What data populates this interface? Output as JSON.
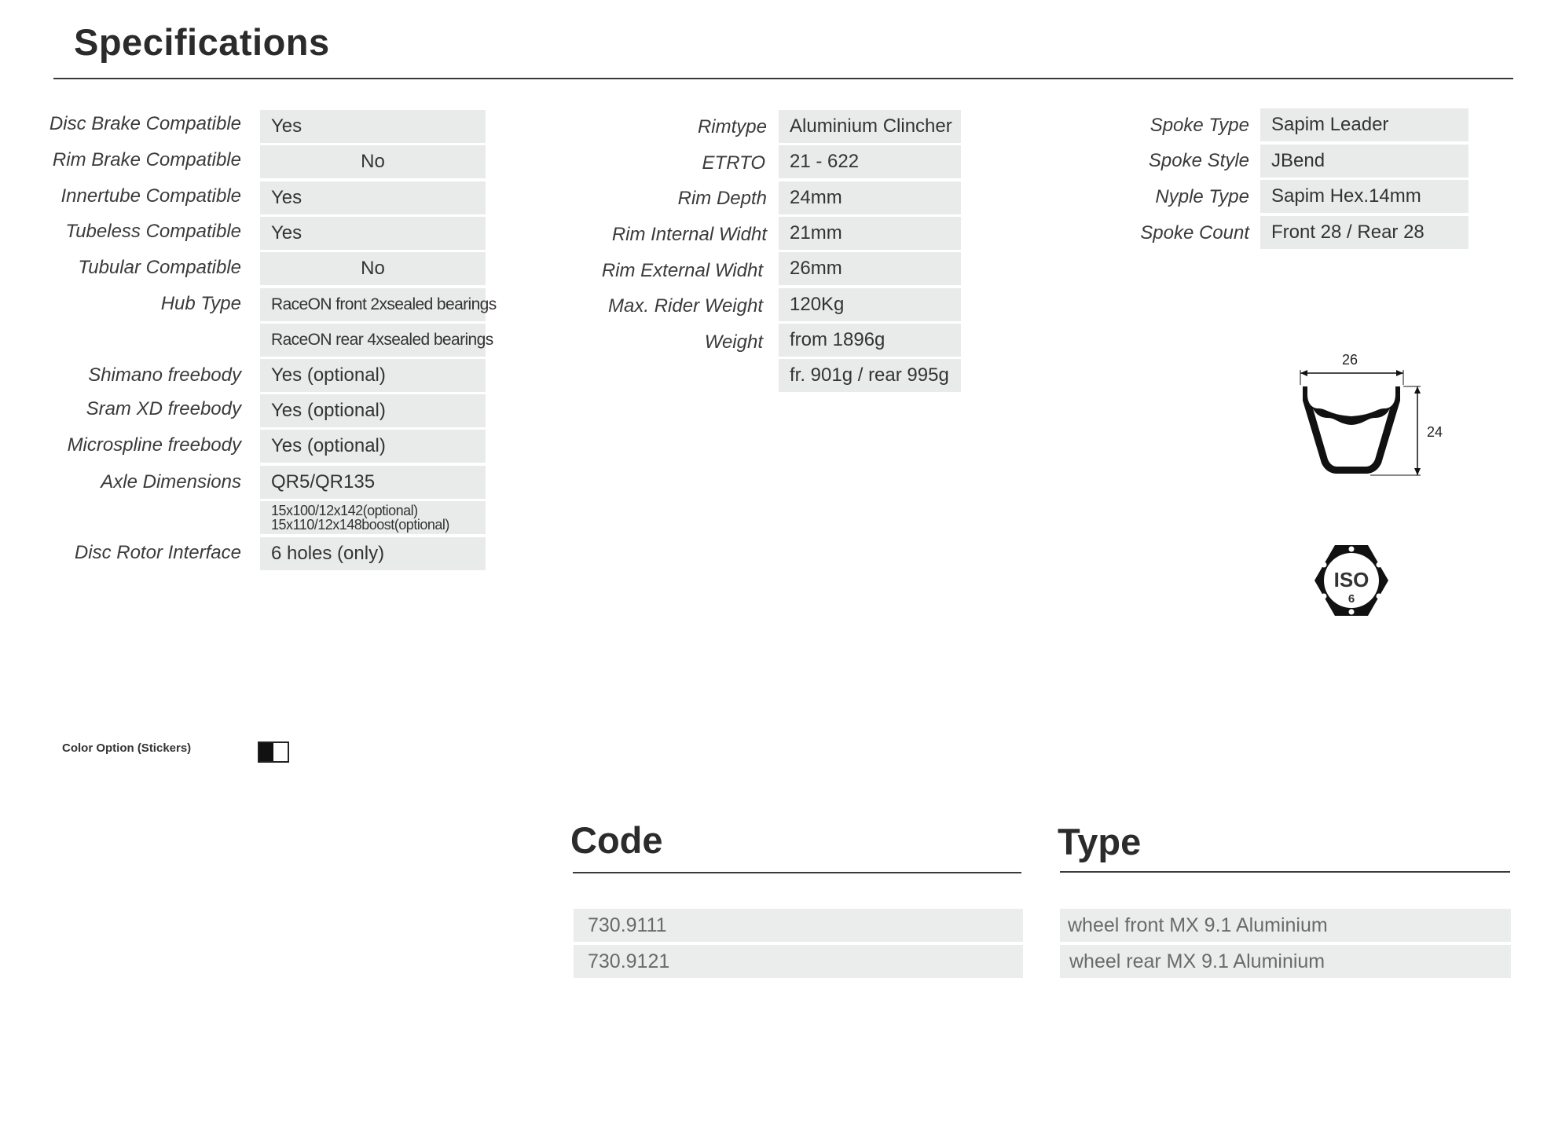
{
  "title": "Specifications",
  "col1": [
    {
      "label": "Disc Brake Compatible",
      "value": "Yes"
    },
    {
      "label": "Rim Brake Compatible",
      "value": "No"
    },
    {
      "label": "Innertube Compatible",
      "value": "Yes"
    },
    {
      "label": "Tubeless Compatible",
      "value": "Yes"
    },
    {
      "label": "Tubular Compatible",
      "value": "No"
    },
    {
      "label": "Hub Type",
      "value": "RaceON front 2xsealed bearings"
    },
    {
      "label": "",
      "value": "RaceON rear 4xsealed bearings"
    },
    {
      "label": "Shimano freebody",
      "value": "Yes (optional)"
    },
    {
      "label": "Sram XD freebody",
      "value": "Yes (optional)"
    },
    {
      "label": "Microspline freebody",
      "value": "Yes (optional)"
    },
    {
      "label": "Axle Dimensions",
      "value": "QR5/QR135"
    },
    {
      "label": "",
      "value_line1": "15x100/12x142(optional)",
      "value_line2": "15x110/12x148boost(optional)"
    },
    {
      "label": "Disc Rotor Interface",
      "value": "6 holes (only)"
    }
  ],
  "col2": [
    {
      "label": "Rimtype",
      "value": "Aluminium Clincher"
    },
    {
      "label": "ETRTO",
      "value": "21 - 622"
    },
    {
      "label": "Rim Depth",
      "value": "24mm"
    },
    {
      "label": "Rim Internal Widht",
      "value": "21mm"
    },
    {
      "label": "Rim External Widht",
      "value": "26mm"
    },
    {
      "label": "Max. Rider Weight",
      "value": "120Kg"
    },
    {
      "label": "Weight",
      "value": "from 1896g"
    },
    {
      "label": "",
      "value": "fr. 901g / rear 995g"
    }
  ],
  "col3": [
    {
      "label": "Spoke Type",
      "value": "Sapim Leader"
    },
    {
      "label": "Spoke Style",
      "value": "JBend"
    },
    {
      "label": "Nyple Type",
      "value": "Sapim Hex.14mm"
    },
    {
      "label": "Spoke Count",
      "value": "Front 28 / Rear 28"
    }
  ],
  "rim_diagram": {
    "width_label": "26",
    "depth_label": "24"
  },
  "iso_badge": {
    "text": "ISO",
    "number": "6"
  },
  "color_option": {
    "label": "Color Option (Stickers)",
    "colors": [
      "#111111",
      "#ffffff"
    ]
  },
  "code_heading": "Code",
  "type_heading": "Type",
  "products": [
    {
      "code": "730.9111",
      "type": "wheel front MX 9.1 Aluminium"
    },
    {
      "code": "730.9121",
      "type": "wheel rear MX 9.1 Aluminium"
    }
  ]
}
